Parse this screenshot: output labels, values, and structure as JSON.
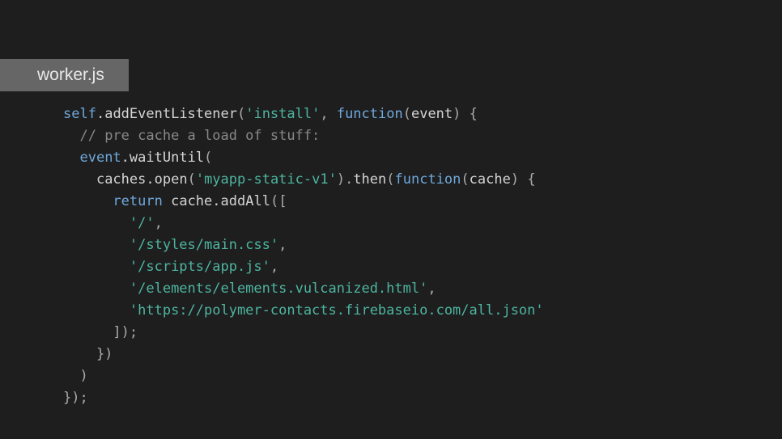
{
  "tab": {
    "filename": "worker.js"
  },
  "code": {
    "tokens": [
      [
        {
          "t": "self",
          "c": "variable"
        },
        {
          "t": ".",
          "c": "default"
        },
        {
          "t": "addEventListener",
          "c": "call"
        },
        {
          "t": "(",
          "c": "punct"
        },
        {
          "t": "'install'",
          "c": "string"
        },
        {
          "t": ", ",
          "c": "punct"
        },
        {
          "t": "function",
          "c": "keyword"
        },
        {
          "t": "(",
          "c": "punct"
        },
        {
          "t": "event",
          "c": "param"
        },
        {
          "t": ") {",
          "c": "punct"
        }
      ],
      [
        {
          "t": "  ",
          "c": "default"
        },
        {
          "t": "// pre cache a load of stuff:",
          "c": "comment"
        }
      ],
      [
        {
          "t": "  ",
          "c": "default"
        },
        {
          "t": "event",
          "c": "variable"
        },
        {
          "t": ".",
          "c": "default"
        },
        {
          "t": "waitUntil",
          "c": "call"
        },
        {
          "t": "(",
          "c": "punct"
        }
      ],
      [
        {
          "t": "    ",
          "c": "default"
        },
        {
          "t": "caches",
          "c": "default"
        },
        {
          "t": ".",
          "c": "default"
        },
        {
          "t": "open",
          "c": "call"
        },
        {
          "t": "(",
          "c": "punct"
        },
        {
          "t": "'myapp-static-v1'",
          "c": "string"
        },
        {
          "t": ").",
          "c": "punct"
        },
        {
          "t": "then",
          "c": "call"
        },
        {
          "t": "(",
          "c": "punct"
        },
        {
          "t": "function",
          "c": "keyword"
        },
        {
          "t": "(",
          "c": "punct"
        },
        {
          "t": "cache",
          "c": "param"
        },
        {
          "t": ") {",
          "c": "punct"
        }
      ],
      [
        {
          "t": "      ",
          "c": "default"
        },
        {
          "t": "return",
          "c": "keyword"
        },
        {
          "t": " ",
          "c": "default"
        },
        {
          "t": "cache",
          "c": "default"
        },
        {
          "t": ".",
          "c": "default"
        },
        {
          "t": "addAll",
          "c": "call"
        },
        {
          "t": "([",
          "c": "punct"
        }
      ],
      [
        {
          "t": "        ",
          "c": "default"
        },
        {
          "t": "'/'",
          "c": "string"
        },
        {
          "t": ",",
          "c": "punct"
        }
      ],
      [
        {
          "t": "        ",
          "c": "default"
        },
        {
          "t": "'/styles/main.css'",
          "c": "string"
        },
        {
          "t": ",",
          "c": "punct"
        }
      ],
      [
        {
          "t": "        ",
          "c": "default"
        },
        {
          "t": "'/scripts/app.js'",
          "c": "string"
        },
        {
          "t": ",",
          "c": "punct"
        }
      ],
      [
        {
          "t": "        ",
          "c": "default"
        },
        {
          "t": "'/elements/elements.vulcanized.html'",
          "c": "string"
        },
        {
          "t": ",",
          "c": "punct"
        }
      ],
      [
        {
          "t": "        ",
          "c": "default"
        },
        {
          "t": "'https://polymer-contacts.firebaseio.com/all.json'",
          "c": "string"
        }
      ],
      [
        {
          "t": "      ]);",
          "c": "punct"
        }
      ],
      [
        {
          "t": "    })",
          "c": "punct"
        }
      ],
      [
        {
          "t": "  )",
          "c": "punct"
        }
      ],
      [
        {
          "t": "});",
          "c": "punct"
        }
      ]
    ]
  }
}
